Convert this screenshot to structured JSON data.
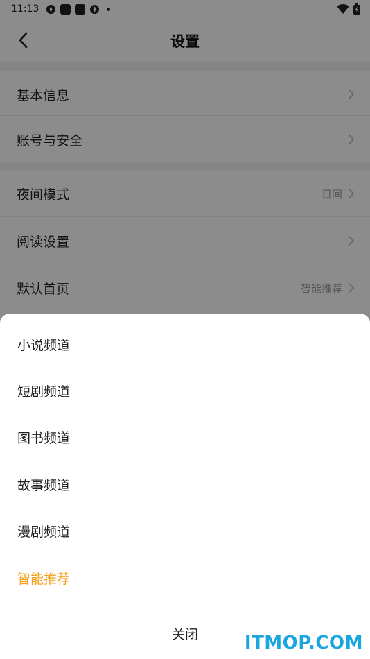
{
  "status_bar": {
    "time": "11:13"
  },
  "header": {
    "title": "设置"
  },
  "settings": {
    "basic_info": "基本信息",
    "account_security": "账号与安全",
    "night_mode": "夜间模式",
    "night_mode_value": "日间",
    "reading_settings": "阅读设置",
    "default_home": "默认首页",
    "default_home_value": "智能推荐"
  },
  "sheet": {
    "options": [
      "小说频道",
      "短剧频道",
      "图书频道",
      "故事频道",
      "漫剧频道",
      "智能推荐"
    ],
    "selected_label": "智能推荐",
    "close_label": "关闭",
    "accent_color": "#f5a01a"
  },
  "watermark": "ITMOP.COM"
}
